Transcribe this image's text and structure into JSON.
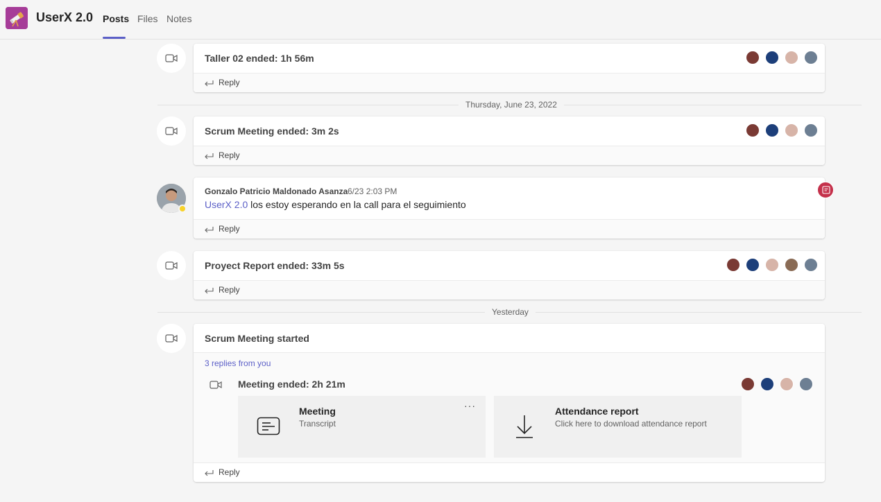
{
  "header": {
    "app_name": "UserX 2.0",
    "tabs": [
      {
        "label": "Posts",
        "active": true
      },
      {
        "label": "Files",
        "active": false
      },
      {
        "label": "Notes",
        "active": false
      }
    ],
    "accent": "#5b5fc7",
    "logo_icon": "telescope-icon"
  },
  "feed": {
    "posts": [
      {
        "type": "meeting",
        "title": "Taller 02 ended: 1h 56m",
        "reply_label": "Reply",
        "participants": 4
      },
      {
        "type": "meeting",
        "title": "Scrum Meeting ended: 3m 2s",
        "reply_label": "Reply",
        "participants": 4
      },
      {
        "type": "message",
        "author": "Gonzalo Patricio Maldonado Asanza",
        "timestamp": "6/23 2:03 PM",
        "mention": "UserX 2.0",
        "body": "los estoy esperando en la call para el seguimiento",
        "reply_label": "Reply",
        "status": "away"
      },
      {
        "type": "meeting",
        "title": "Proyect Report ended: 33m 5s",
        "reply_label": "Reply",
        "participants": 5
      },
      {
        "type": "meeting-thread",
        "title": "Scrum Meeting started",
        "replies_link": "3 replies from you",
        "nested_title": "Meeting ended: 2h 21m",
        "participants": 4,
        "tiles": [
          {
            "title": "Meeting",
            "subtitle": "Transcript",
            "icon": "transcript-icon",
            "more": "···"
          },
          {
            "title": "Attendance report",
            "subtitle": "Click here to download attendance report",
            "icon": "download-icon"
          }
        ],
        "reply_label": "Reply"
      }
    ],
    "dividers": [
      "Thursday, June 23, 2022",
      "Yesterday"
    ]
  }
}
